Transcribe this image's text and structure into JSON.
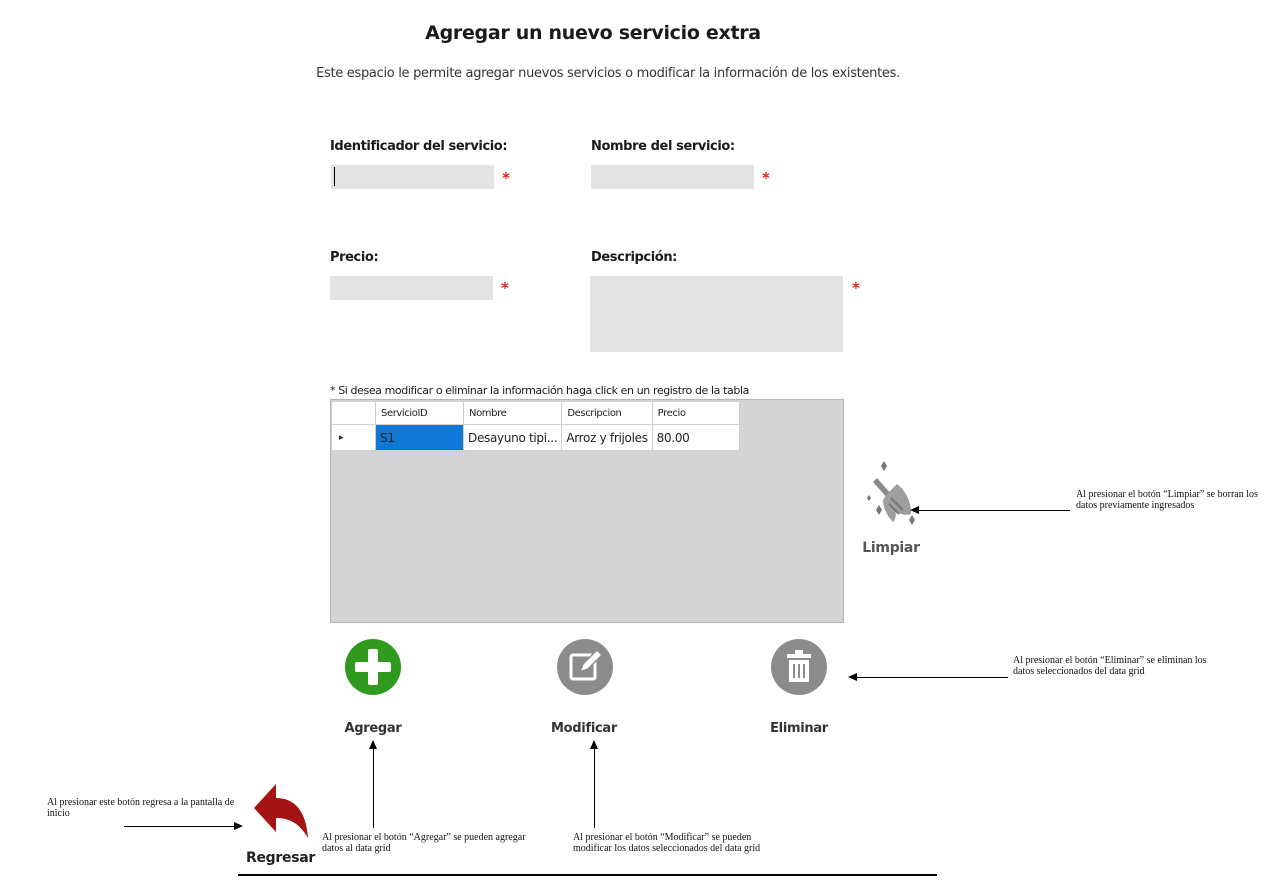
{
  "page": {
    "title": "Agregar un nuevo servicio extra",
    "subtitle": "Este espacio le permite agregar nuevos servicios o modificar la información de los existentes."
  },
  "form": {
    "id_label": "Identificador del servicio:",
    "id_value": "",
    "name_label": "Nombre del servicio:",
    "name_value": "",
    "price_label": "Precio:",
    "price_value": "",
    "desc_label": "Descripción:",
    "desc_value": "",
    "required_mark": "*"
  },
  "grid": {
    "note": "* Si desea modificar o eliminar la información haga click en un registro de la tabla",
    "columns": [
      "ServicioID",
      "Nombre",
      "Descripcion",
      "Precio"
    ],
    "rows": [
      {
        "selector": "▸",
        "ServicioID": "S1",
        "Nombre": "Desayuno tipi...",
        "Descripcion": "Arroz y frijoles",
        "Precio": "80.00"
      }
    ]
  },
  "buttons": {
    "agregar": "Agregar",
    "modificar": "Modificar",
    "eliminar": "Eliminar",
    "limpiar": "Limpiar",
    "regresar": "Regresar"
  },
  "annotations": {
    "limpiar": "Al presionar el botón “Limpiar” se borran los datos previamente ingresados",
    "eliminar": "Al presionar el botón “Eliminar” se eliminan los datos seleccionados del data grid",
    "agregar": "Al presionar el botón “Agregar” se pueden agregar datos al data grid",
    "modificar": "Al presionar el botón “Modificar” se pueden modificar los datos seleccionados del data grid",
    "regresar": "Al presionar este botón regresa a la pantalla de inicio"
  },
  "colors": {
    "agregar": "#2f9a1e",
    "disabled": "#8c8c8c",
    "regresar": "#a41414",
    "selection": "#0f78d7",
    "required": "#e8231f"
  }
}
